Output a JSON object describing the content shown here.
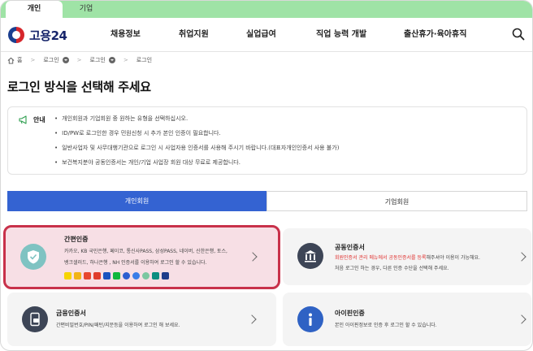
{
  "top_tabs": [
    "개인",
    "기업"
  ],
  "logo": "고용24",
  "menu": [
    "채용정보",
    "취업지원",
    "실업급여",
    "직업 능력 개발",
    "출산휴가·육아휴직"
  ],
  "breadcrumb": [
    "홈",
    "로그인",
    "로그인",
    "로그인"
  ],
  "page_title": "로그인 방식을 선택해 주세요",
  "notice": {
    "label": "안내",
    "items": [
      "개인회원과 기업회원 중 원하는 유형을 선택하십시오.",
      "ID/PW로 로그인한 경우 민원신청 시 추가 본인 인증이 필요합니다.",
      "일반사업자 및 사무대행기관으로 로그인 시 사업자용 인증서를 사용해 주시기 바랍니다.(대표자개인인증서 사용 불가)",
      "보건복지분야 공동인증서는 개인/기업 사업장 회원 대상 무료로 제공합니다."
    ]
  },
  "member_tabs": [
    "개인회원",
    "기업회원"
  ],
  "cards": {
    "easy": {
      "title": "간편인증",
      "desc1": "카카오, KB 국민은행, 페이코, 통신사PASS, 삼성PASS, 네이버, 신한은행, 토스,",
      "desc2": "뱅크샐러드, 하나은행 , NH 인증서를 이용하여 로그인 할 수 있습니다."
    },
    "joint": {
      "title": "공동인증서",
      "desc1_red": "회원인증서 관리 메뉴에서 공동인증서를 등록",
      "desc1_rest": "해주셔야 이용이 가능해요.",
      "desc2": "처음 로그인 하는 경우, 다른 인증 수단을 선택해 주세요."
    },
    "finance": {
      "title": "금융인증서",
      "desc1": "간편비밀번호/PIN/패턴/지문등을 이용하여 로그인 해 보세요."
    },
    "ipin": {
      "title": "아이핀인증",
      "desc1": "본인 아이핀정보로 인증 후 로그인 할 수 있습니다."
    }
  },
  "colors": {
    "accent": "#3463d2",
    "topbar": "#9fe3a6",
    "highlight_border": "#c8314a",
    "highlight_bg": "#f7dfe5",
    "warning_text": "#e0302e"
  }
}
